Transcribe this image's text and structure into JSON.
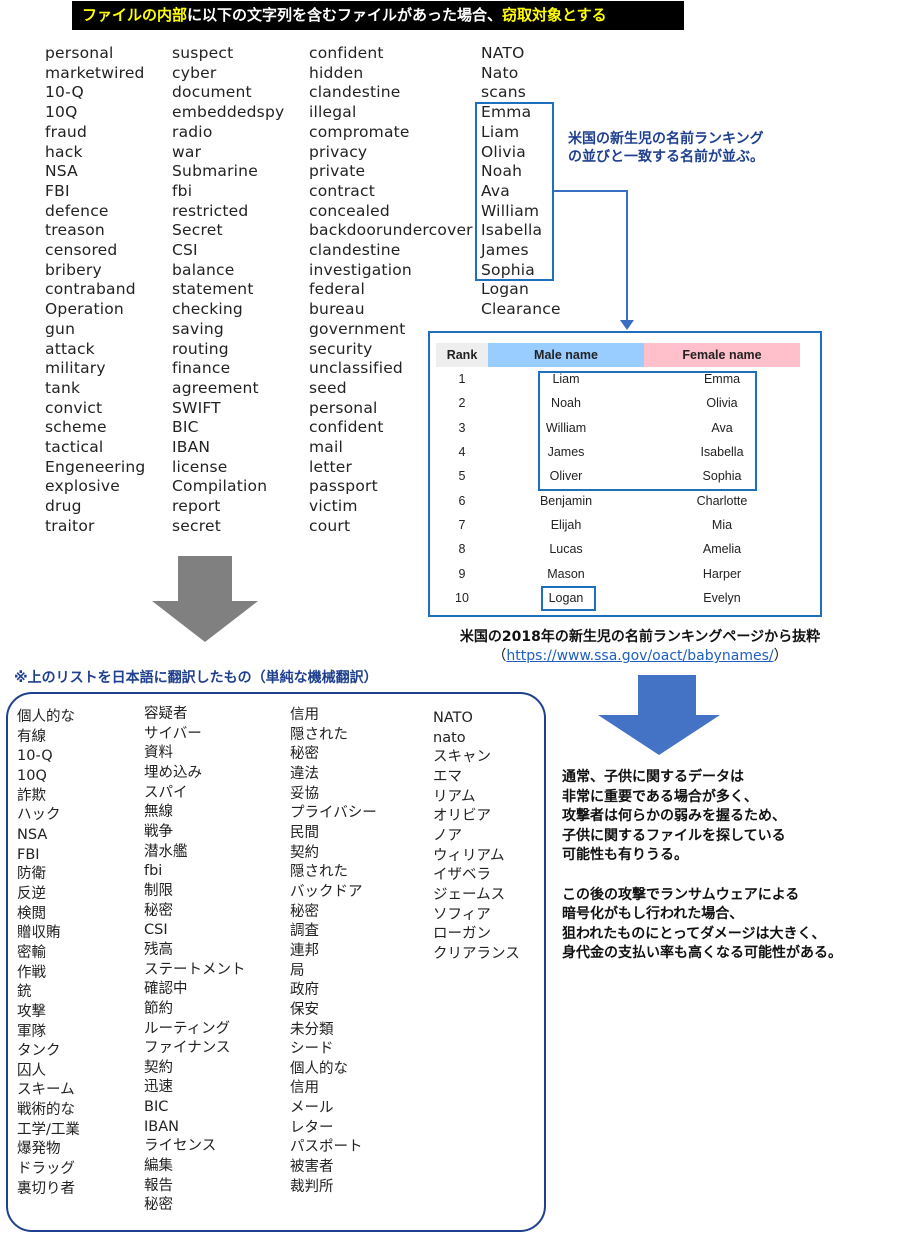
{
  "banner": {
    "part1": "ファイルの内部",
    "part2": "に以下の文字列を含むファイルがあった場合、",
    "part3": "窃取対象とする"
  },
  "keywords_en": {
    "col1": [
      "personal",
      "marketwired",
      "10-Q",
      "10Q",
      "fraud",
      "hack",
      "NSA",
      "FBI",
      "defence",
      "treason",
      "censored",
      "bribery",
      "contraband",
      "Operation",
      "gun",
      "attack",
      "military",
      "tank",
      "convict",
      "scheme",
      "tactical",
      "Engeneering",
      "explosive",
      "drug",
      "traitor"
    ],
    "col2": [
      "suspect",
      "cyber",
      "document",
      "embeddedspy",
      "radio",
      "war",
      "Submarine",
      "fbi",
      "restricted",
      "Secret",
      "CSI",
      "balance",
      "statement",
      "checking",
      "saving",
      "routing",
      "finance",
      "agreement",
      "SWIFT",
      "BIC",
      "IBAN",
      "license",
      "Compilation",
      "report",
      "secret"
    ],
    "col3": [
      "confident",
      "hidden",
      "clandestine",
      "illegal",
      "compromate",
      "privacy",
      "private",
      "contract",
      "concealed",
      "backdoorundercover",
      "clandestine",
      "investigation",
      "federal",
      "bureau",
      "government",
      "security",
      "unclassified",
      "seed",
      "personal",
      "confident",
      "mail",
      "letter",
      "passport",
      "victim",
      "court"
    ],
    "col4": [
      "NATO",
      "Nato",
      "scans",
      "Emma",
      "Liam",
      "Olivia",
      "Noah",
      "Ava",
      "William",
      "Isabella",
      "James",
      "Sophia",
      "Logan",
      "Clearance"
    ]
  },
  "callout": {
    "line1": "米国の新生児の名前ランキング",
    "line2": "の並びと一致する名前が並ぶ。"
  },
  "ranking_table": {
    "headers": [
      "Rank",
      "Male name",
      "Female name"
    ],
    "rows": [
      [
        "1",
        "Liam",
        "Emma"
      ],
      [
        "2",
        "Noah",
        "Olivia"
      ],
      [
        "3",
        "William",
        "Ava"
      ],
      [
        "4",
        "James",
        "Isabella"
      ],
      [
        "5",
        "Oliver",
        "Sophia"
      ],
      [
        "6",
        "Benjamin",
        "Charlotte"
      ],
      [
        "7",
        "Elijah",
        "Mia"
      ],
      [
        "8",
        "Lucas",
        "Amelia"
      ],
      [
        "9",
        "Mason",
        "Harper"
      ],
      [
        "10",
        "Logan",
        "Evelyn"
      ]
    ]
  },
  "source": {
    "caption": "米国の2018年の新生児の名前ランキングページから抜粋",
    "open_paren": "（",
    "link": "https://www.ssa.gov/oact/babynames/",
    "close_paren": "）"
  },
  "translation": {
    "title": "※上のリストを日本語に翻訳したもの（単純な機械翻訳）",
    "col1": [
      "個人的な",
      "有線",
      "10-Q",
      "10Q",
      "詐欺",
      "ハック",
      "NSA",
      "FBI",
      "防衛",
      "反逆",
      "検閲",
      "贈収賄",
      "密輸",
      "作戦",
      "銃",
      "攻撃",
      "軍隊",
      "タンク",
      "囚人",
      "スキーム",
      "戦術的な",
      "工学/工業",
      "爆発物",
      "ドラッグ",
      "裏切り者"
    ],
    "col2": [
      "容疑者",
      "サイバー",
      "資料",
      "埋め込み",
      "スパイ",
      "無線",
      "戦争",
      "潜水艦",
      "fbi",
      "制限",
      "秘密",
      "CSI",
      "残高",
      "ステートメント",
      "確認中",
      "節約",
      "ルーティング",
      "ファイナンス",
      "契約",
      "迅速",
      "BIC",
      "IBAN",
      "ライセンス",
      "編集",
      "報告",
      "秘密"
    ],
    "col3": [
      "信用",
      "隠された",
      "秘密",
      "違法",
      "妥協",
      "プライバシー",
      "民間",
      "契約",
      "隠された",
      "バックドア",
      "秘密",
      "調査",
      "連邦",
      "局",
      "政府",
      "保安",
      "未分類",
      "シード",
      "個人的な",
      "信用",
      "メール",
      "レター",
      "パスポート",
      "被害者",
      "裁判所"
    ],
    "col4": [
      "NATO",
      "nato",
      "スキャン",
      "エマ",
      "リアム",
      "オリビア",
      "ノア",
      "ウィリアム",
      "イザベラ",
      "ジェームス",
      "ソフィア",
      "ローガン",
      "クリアランス"
    ]
  },
  "analysis": {
    "lines": [
      "通常、子供に関するデータは",
      "非常に重要である場合が多く、",
      "攻撃者は何らかの弱みを握るため、",
      "子供に関するファイルを探している",
      "可能性も有りうる。",
      "",
      "この後の攻撃でランサムウェアによる",
      "暗号化がもし行われた場合、",
      "狙われたものにとってダメージは大きく、",
      "身代金の支払い率も高くなる可能性がある。"
    ]
  },
  "colors": {
    "banner_bg": "#000000",
    "banner_highlight": "#ffff00",
    "box_blue": "#1f6fbf",
    "navy_text": "#1f3f8f",
    "gray_arrow": "#808080",
    "blue_arrow": "#4472c4",
    "male_header": "#99ccff",
    "female_header": "#ffc0cb"
  }
}
